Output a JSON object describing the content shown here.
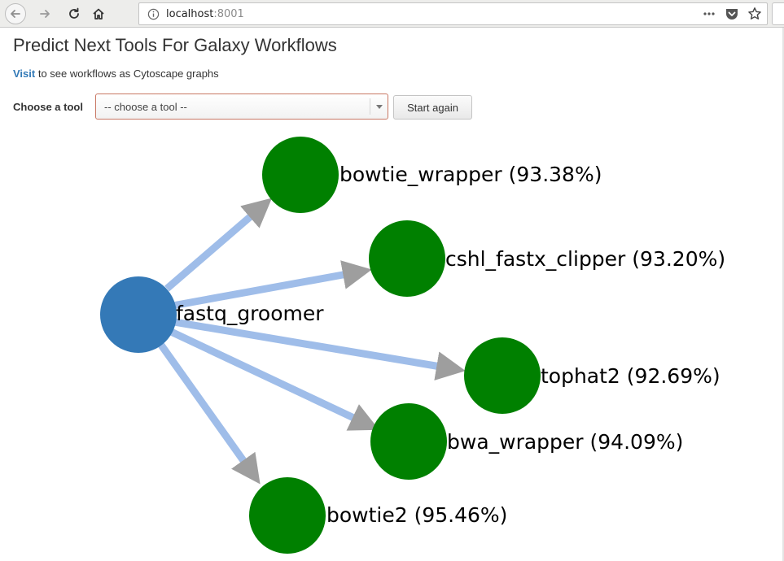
{
  "browser": {
    "url_host": "localhost",
    "url_port": ":8001"
  },
  "page": {
    "title": "Predict Next Tools For Galaxy Workflows",
    "visit_link": "Visit",
    "visit_text": " to see workflows as Cytoscape graphs",
    "tool_label": "Choose a tool",
    "tool_select_value": "-- choose a tool --",
    "start_again_label": "Start again"
  },
  "graph": {
    "colors": {
      "source_node": "#3479b7",
      "target_node": "#008000",
      "edge": "#9fbde9",
      "arrow": "#9e9e9e"
    },
    "source": {
      "label": "fastq_groomer"
    },
    "targets": [
      {
        "label": "bowtie_wrapper (93.38%)"
      },
      {
        "label": "cshl_fastx_clipper (93.20%)"
      },
      {
        "label": "tophat2 (92.69%)"
      },
      {
        "label": "bwa_wrapper (94.09%)"
      },
      {
        "label": "bowtie2 (95.46%)"
      }
    ]
  }
}
